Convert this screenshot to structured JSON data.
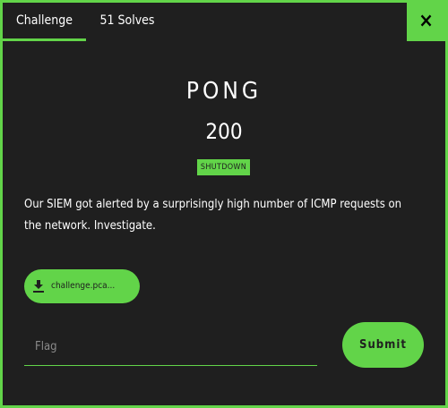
{
  "tabs": [
    {
      "label": "Challenge"
    },
    {
      "label": "51 Solves"
    }
  ],
  "close_label": "×",
  "challenge": {
    "name": "PONG",
    "points": "200",
    "tag": "SHUTDOWN",
    "description": "Our SIEM got alerted by a surprisingly high number of ICMP requests on the network. Investigate.",
    "file": {
      "label": "challenge.pca...",
      "icon": "download-icon"
    }
  },
  "flag_input": {
    "placeholder": "Flag",
    "value": ""
  },
  "submit_label": "Submit",
  "colors": {
    "accent": "#62d449",
    "background": "#1f1f1f",
    "text": "#ffffff"
  }
}
